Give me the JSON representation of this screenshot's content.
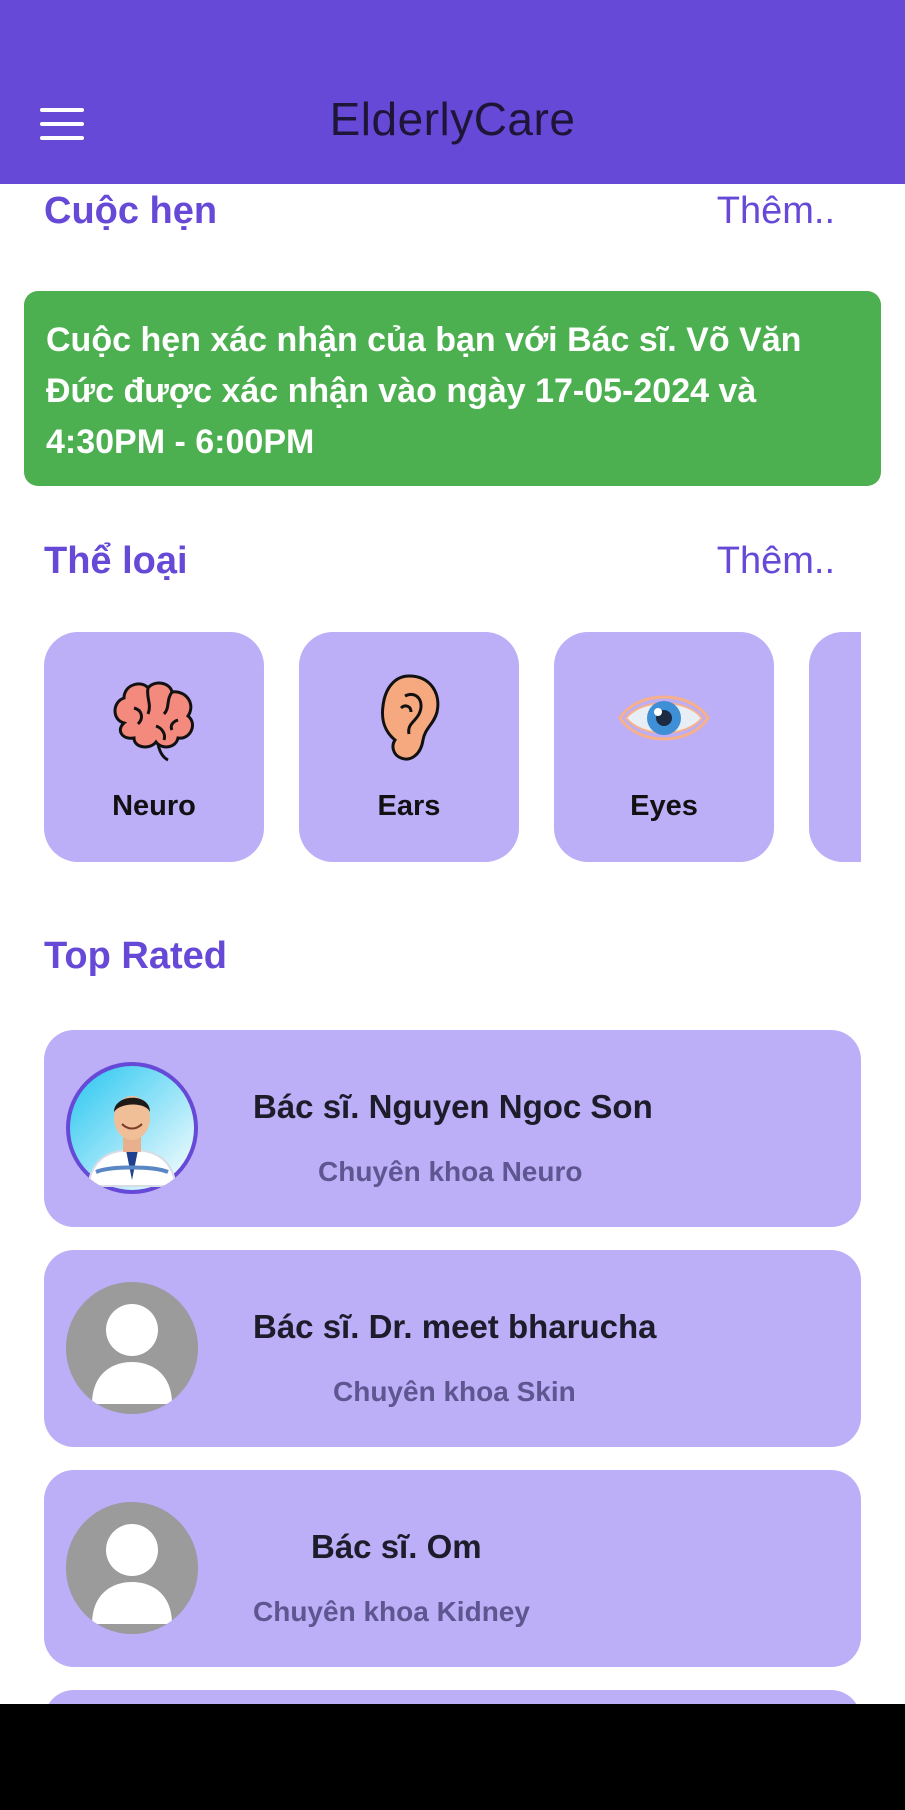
{
  "appbar": {
    "title": "ElderlyCare",
    "menu_icon": "hamburger-menu-icon"
  },
  "appointments": {
    "title": "Cuộc hẹn",
    "more": "Thêm..",
    "card_text": " Cuộc hẹn xác nhận của bạn với Bác sĩ. Võ Văn Đức được xác nhận vào ngày 17-05-2024 và 4:30PM - 6:00PM",
    "card_color": "#4caf50"
  },
  "categories": {
    "title": "Thể loại",
    "more": "Thêm..",
    "items": [
      {
        "label": "Neuro",
        "icon": "brain-icon"
      },
      {
        "label": "Ears",
        "icon": "ear-icon"
      },
      {
        "label": "Eyes",
        "icon": "eye-icon"
      }
    ]
  },
  "top_rated": {
    "title": "Top Rated",
    "doctors": [
      {
        "name": "Bác sĩ. Nguyen Ngoc Son",
        "specialty": "Chuyên khoa Neuro",
        "avatar": "doctor-photo"
      },
      {
        "name": "Bác sĩ. Dr. meet bharucha",
        "specialty": "Chuyên khoa Skin",
        "avatar": "default-user-icon"
      },
      {
        "name": "Bác sĩ. Om",
        "specialty": "Chuyên khoa Kidney",
        "avatar": "default-user-icon"
      }
    ]
  },
  "colors": {
    "primary": "#6649d7",
    "card": "#bcaef7",
    "success": "#4caf50",
    "title_text": "#1e1638"
  }
}
